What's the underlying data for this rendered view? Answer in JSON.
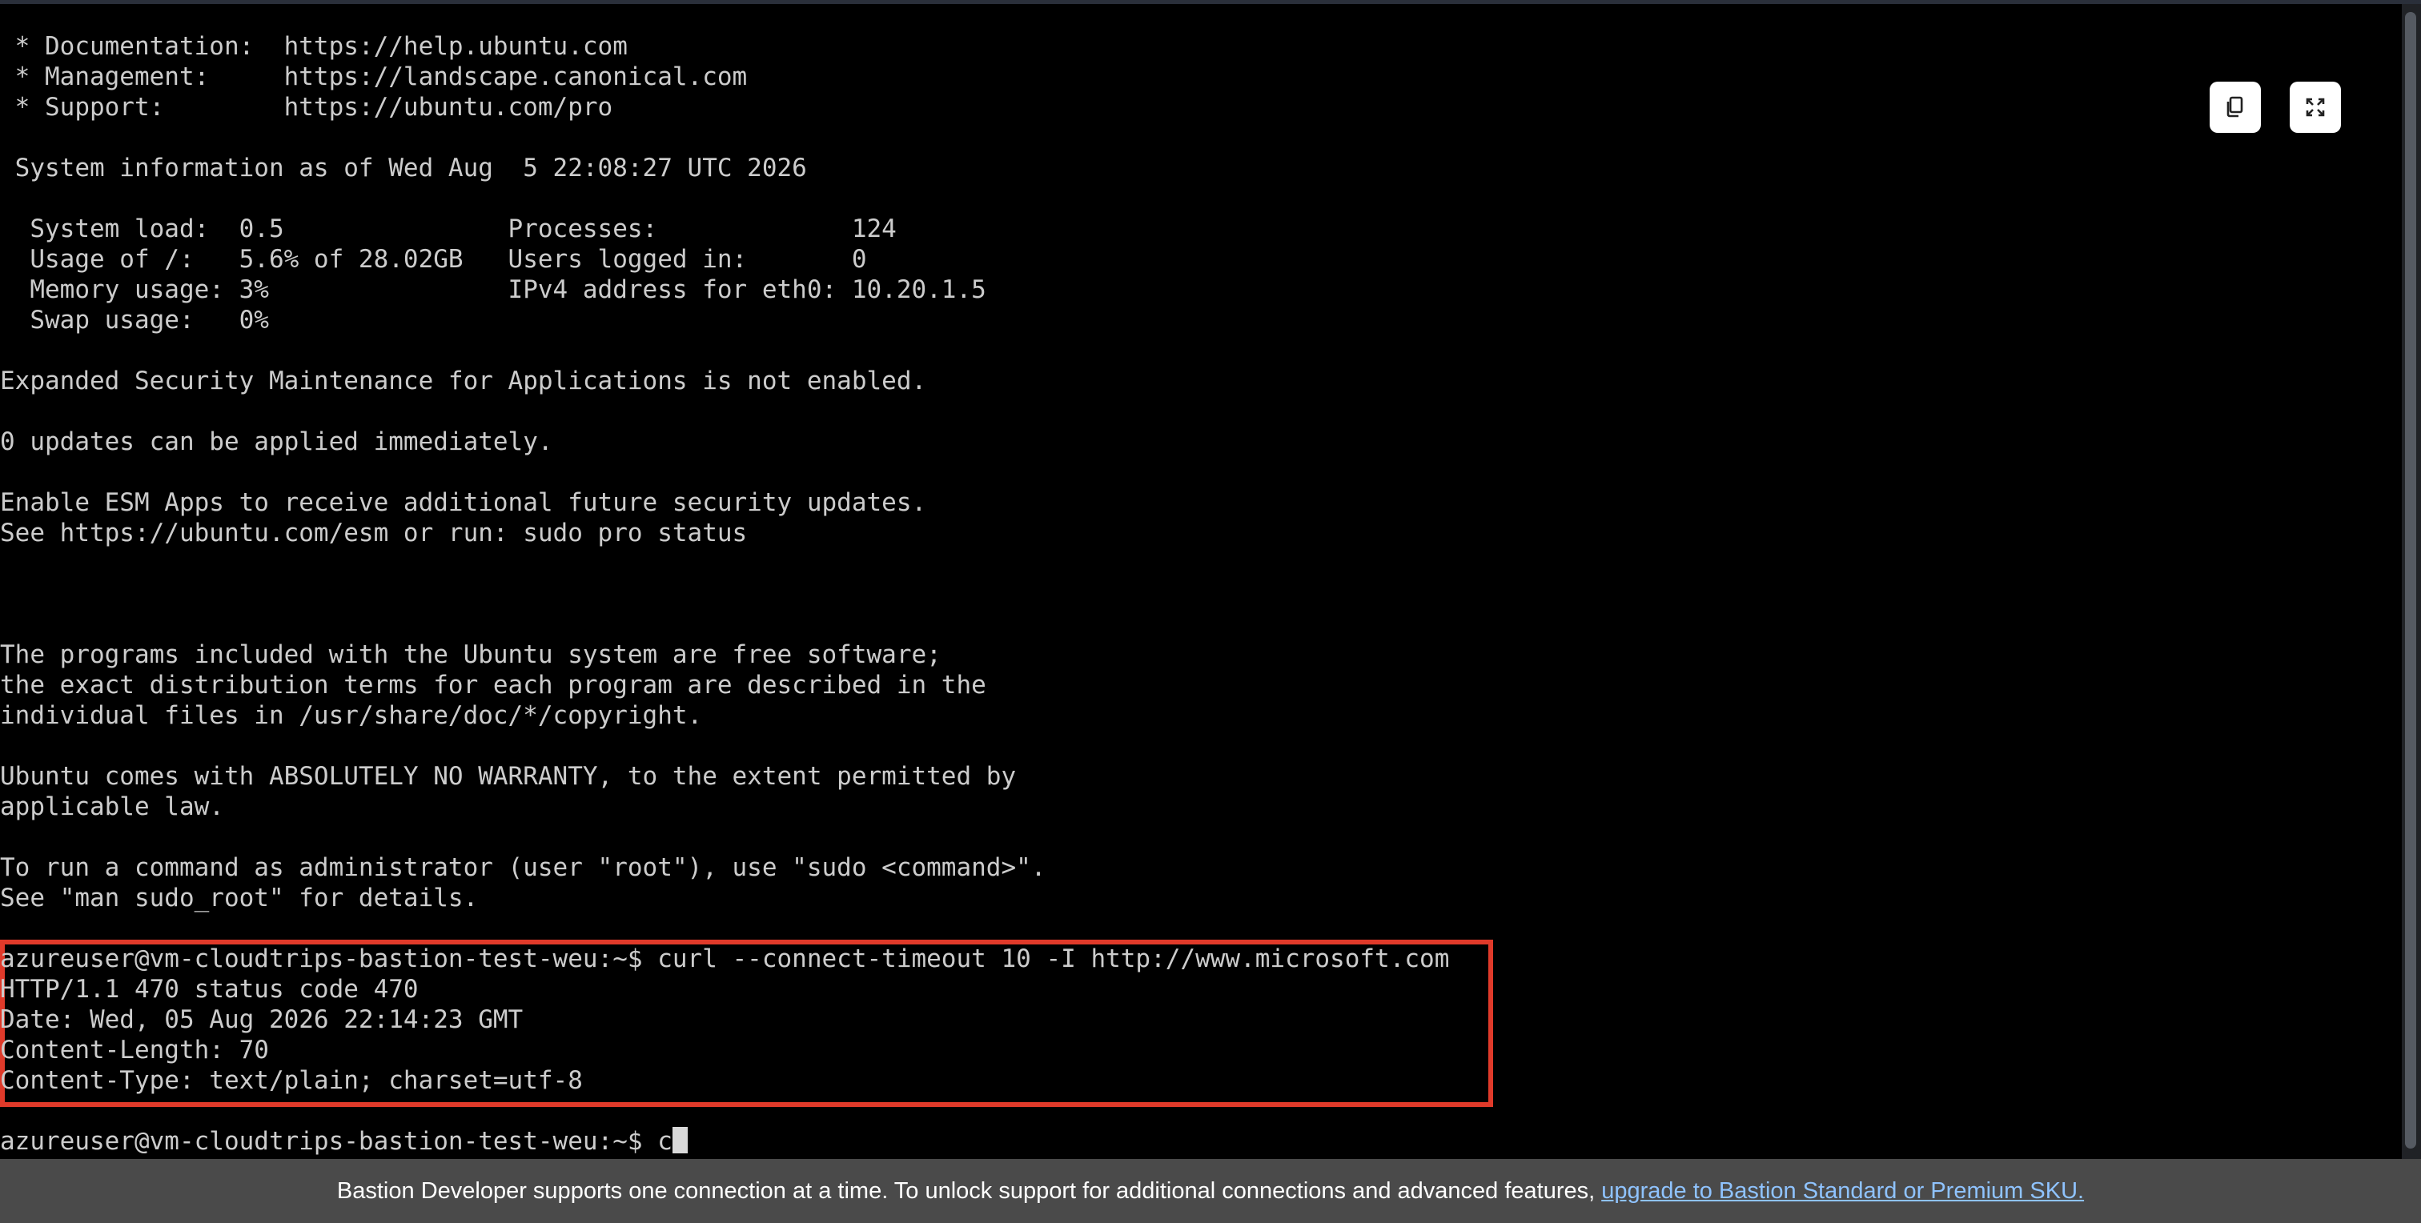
{
  "terminal": {
    "lines": [
      " * Documentation:  https://help.ubuntu.com",
      " * Management:     https://landscape.canonical.com",
      " * Support:        https://ubuntu.com/pro",
      "",
      " System information as of Wed Aug  5 22:08:27 UTC 2026",
      "",
      "  System load:  0.5               Processes:             124",
      "  Usage of /:   5.6% of 28.02GB   Users logged in:       0",
      "  Memory usage: 3%                IPv4 address for eth0: 10.20.1.5",
      "  Swap usage:   0%",
      "",
      "Expanded Security Maintenance for Applications is not enabled.",
      "",
      "0 updates can be applied immediately.",
      "",
      "Enable ESM Apps to receive additional future security updates.",
      "See https://ubuntu.com/esm or run: sudo pro status",
      "",
      "",
      "",
      "The programs included with the Ubuntu system are free software;",
      "the exact distribution terms for each program are described in the",
      "individual files in /usr/share/doc/*/copyright.",
      "",
      "Ubuntu comes with ABSOLUTELY NO WARRANTY, to the extent permitted by",
      "applicable law.",
      "",
      "To run a command as administrator (user \"root\"), use \"sudo <command>\".",
      "See \"man sudo_root\" for details.",
      "",
      "azureuser@vm-cloudtrips-bastion-test-weu:~$ curl --connect-timeout 10 -I http://www.microsoft.com",
      "HTTP/1.1 470 status code 470",
      "Date: Wed, 05 Aug 2026 22:14:23 GMT",
      "Content-Length: 70",
      "Content-Type: text/plain; charset=utf-8",
      "",
      "azureuser@vm-cloudtrips-bastion-test-weu:~$ c"
    ]
  },
  "toolbar": {
    "copy_icon": "clipboard-icon",
    "fullscreen_icon": "fullscreen-icon"
  },
  "banner": {
    "text": "Bastion Developer supports one connection at a time. To unlock support for additional connections and advanced features,",
    "link_text": "upgrade to Bastion Standard or Premium SKU."
  },
  "colors": {
    "terminal_bg": "#000000",
    "terminal_text": "#cccccc",
    "highlight": "#e03a2a",
    "banner_bg": "#4a4a4a",
    "link": "#8fc3ff"
  }
}
